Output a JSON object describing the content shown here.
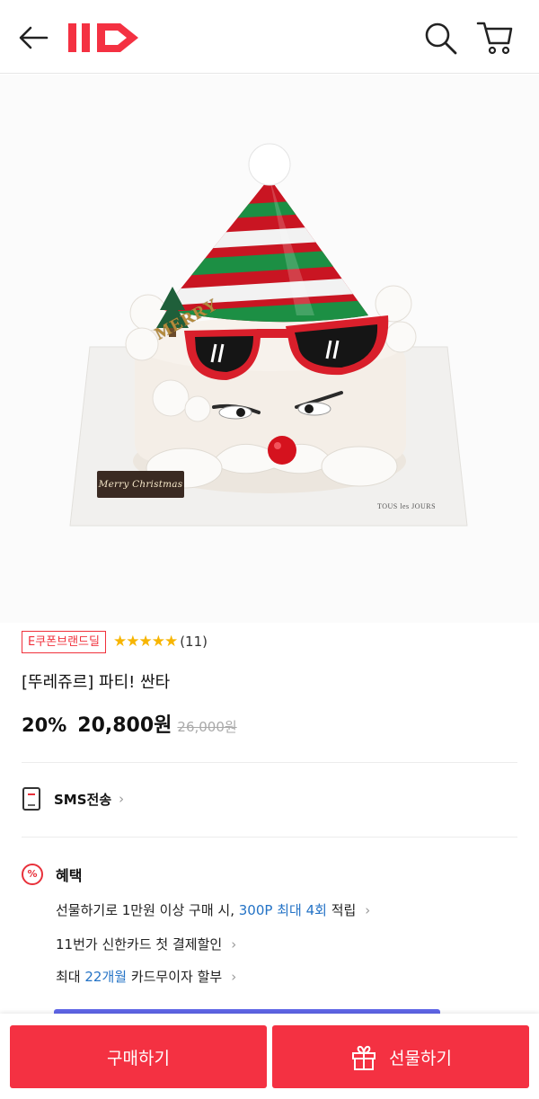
{
  "header": {
    "logo_text": "11",
    "icons": [
      "back-arrow-icon",
      "search-icon",
      "cart-icon"
    ],
    "brand_color": "#f43142"
  },
  "product_image": {
    "plaque_text": "Merry Christmas",
    "topper_text": "MERRY",
    "board_brand": "TOUS les JOURS"
  },
  "product": {
    "badge": "E쿠폰브랜드딜",
    "stars": "★★★★★",
    "rating": 5,
    "review_count": "(11)",
    "title": "[뚜레쥬르] 파티! 싼타",
    "discount": "20%",
    "sale_price": "20,800원",
    "original_price": "26,000원"
  },
  "sms": {
    "label": "SMS전송",
    "chevron": "›"
  },
  "benefits": {
    "icon_text": "%",
    "title": "혜택",
    "line1_a": "선물하기로 1만원 이상 구매 시, ",
    "line1_hl": "300P 최대 4회",
    "line1_b": " 적립",
    "line2": "11번가 신한카드 첫 결제할인",
    "line3_a": "최대 ",
    "line3_hl": "22개월",
    "line3_b": " 카드무이자 할부",
    "chevron": "›",
    "highlight_color": "#2473c6"
  },
  "bottom": {
    "buy_label": "구매하기",
    "gift_label": "선물하기",
    "button_color": "#f43142"
  }
}
